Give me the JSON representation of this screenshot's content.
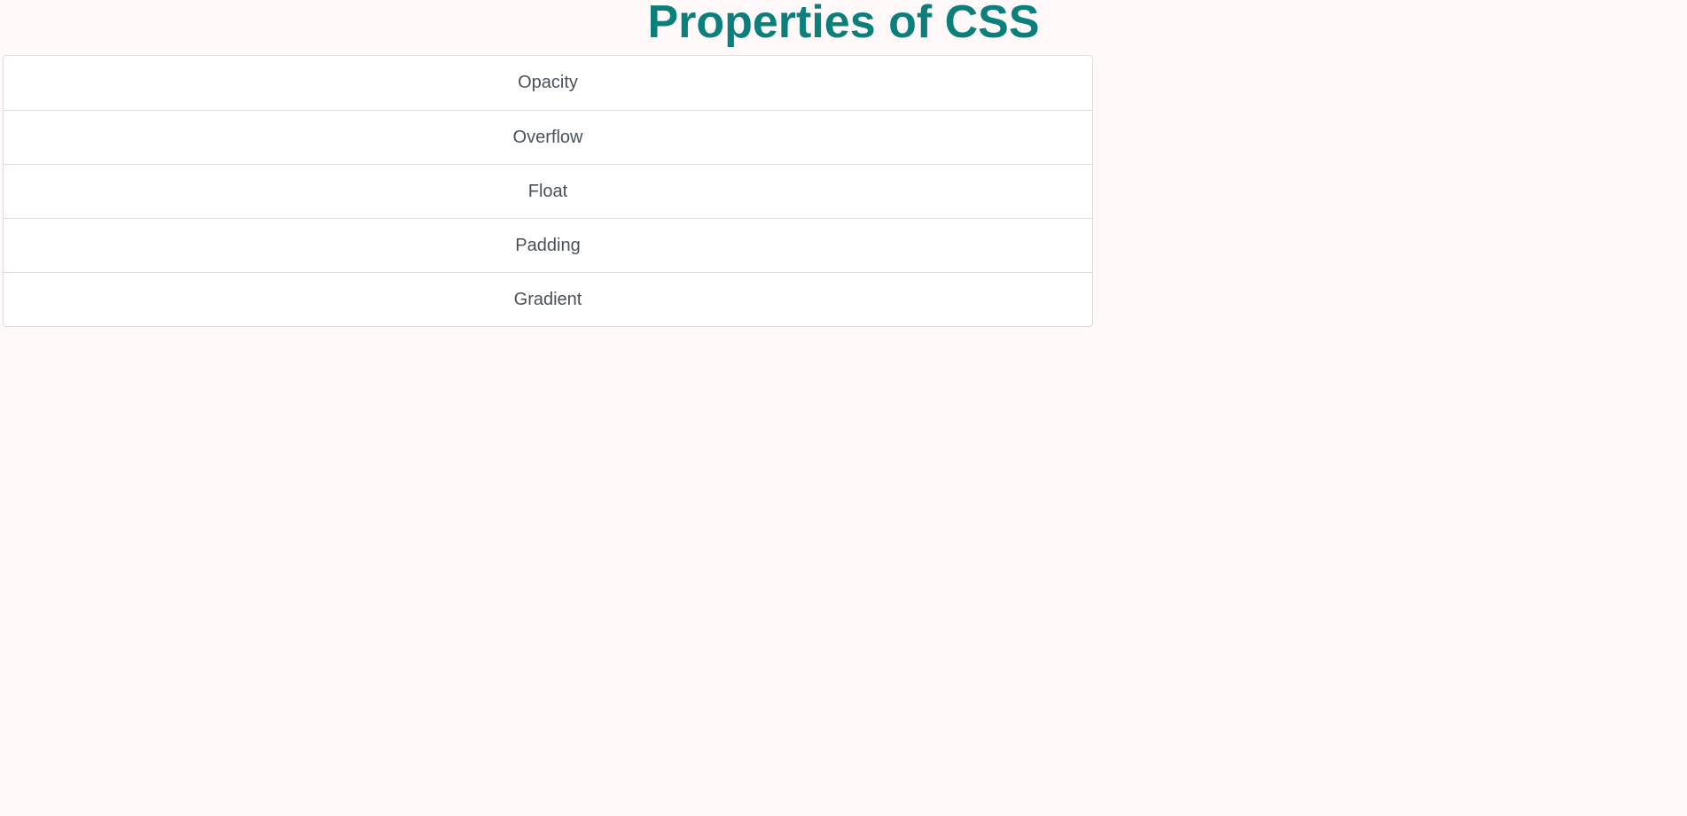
{
  "page": {
    "title": "Properties of CSS",
    "title_color": "#0b7f7c",
    "background_color": "#fffaf9"
  },
  "list": {
    "items": [
      {
        "label": "Opacity"
      },
      {
        "label": "Overflow"
      },
      {
        "label": "Float"
      },
      {
        "label": "Padding"
      },
      {
        "label": "Gradient"
      }
    ]
  }
}
